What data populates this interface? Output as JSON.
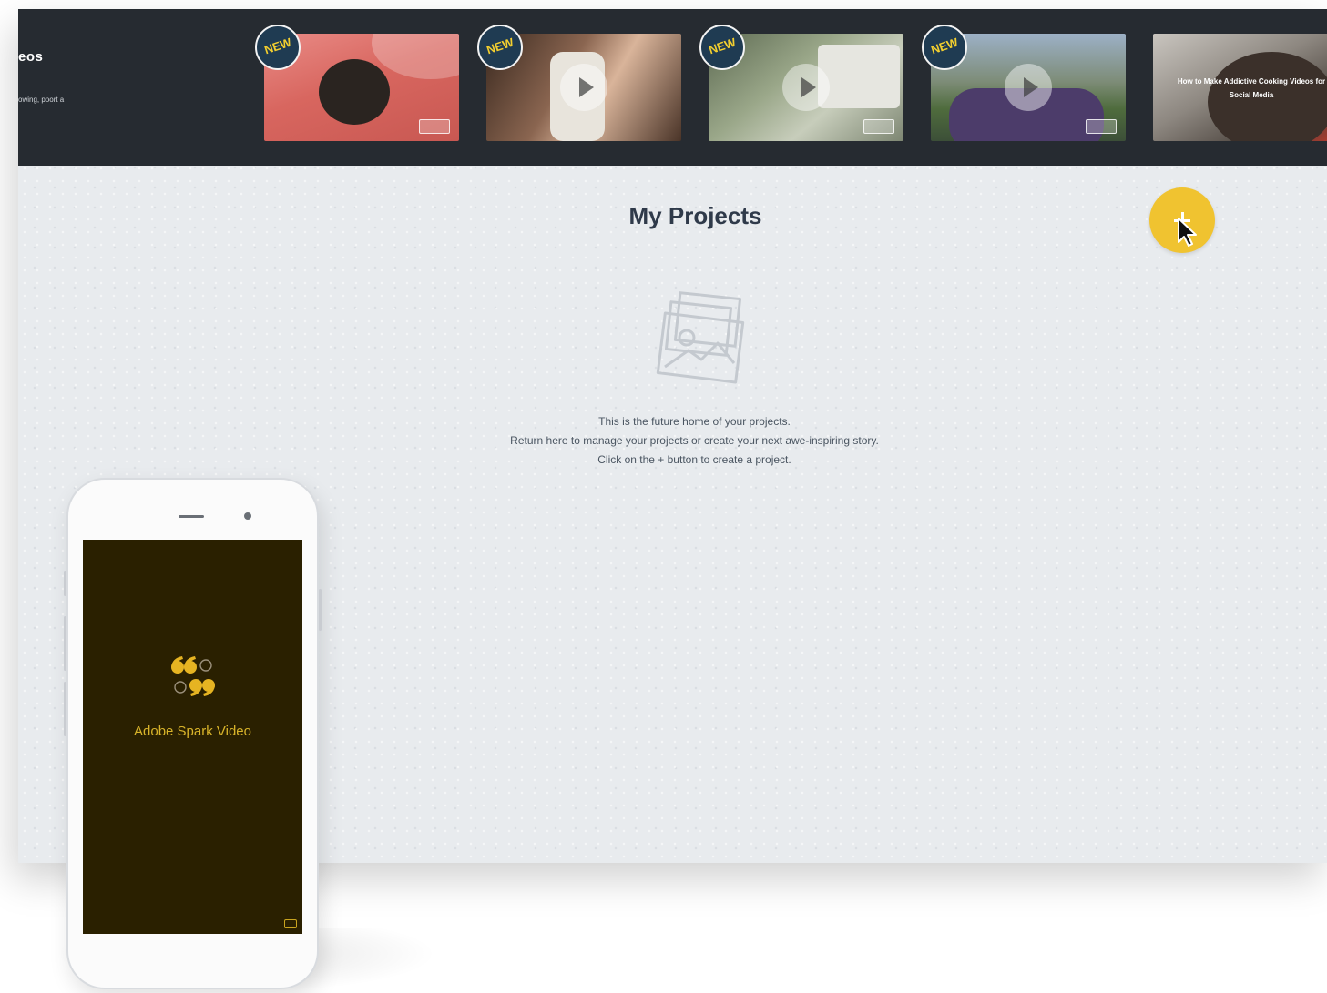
{
  "header": {
    "title": "eos",
    "description": "owing, pport a"
  },
  "thumbnails": [
    {
      "badge": "NEW",
      "duration": "",
      "caption": ""
    },
    {
      "badge": "NEW",
      "duration": "",
      "caption": ""
    },
    {
      "badge": "NEW",
      "duration": "",
      "caption": ""
    },
    {
      "badge": "NEW",
      "duration": "",
      "caption": ""
    },
    {
      "badge": "",
      "duration": "",
      "caption": "How to Make Addictive Cooking Videos for Social Media"
    }
  ],
  "main": {
    "title": "My Projects",
    "empty_state": {
      "line1": "This is the future home of your projects.",
      "line2": "Return here to manage your projects or create your next awe-inspiring story.",
      "line3": "Click on the + button to create a project."
    },
    "add_button_icon": "plus-icon"
  },
  "phone": {
    "app_name": "Adobe Spark Video",
    "logo_icon": "quote-marks-icon"
  },
  "colors": {
    "header_bg": "#262b31",
    "accent_yellow": "#f0c330",
    "page_bg": "#e8ebee",
    "phone_screen_bg": "#2a2000",
    "title_text": "#2f3a4a"
  }
}
